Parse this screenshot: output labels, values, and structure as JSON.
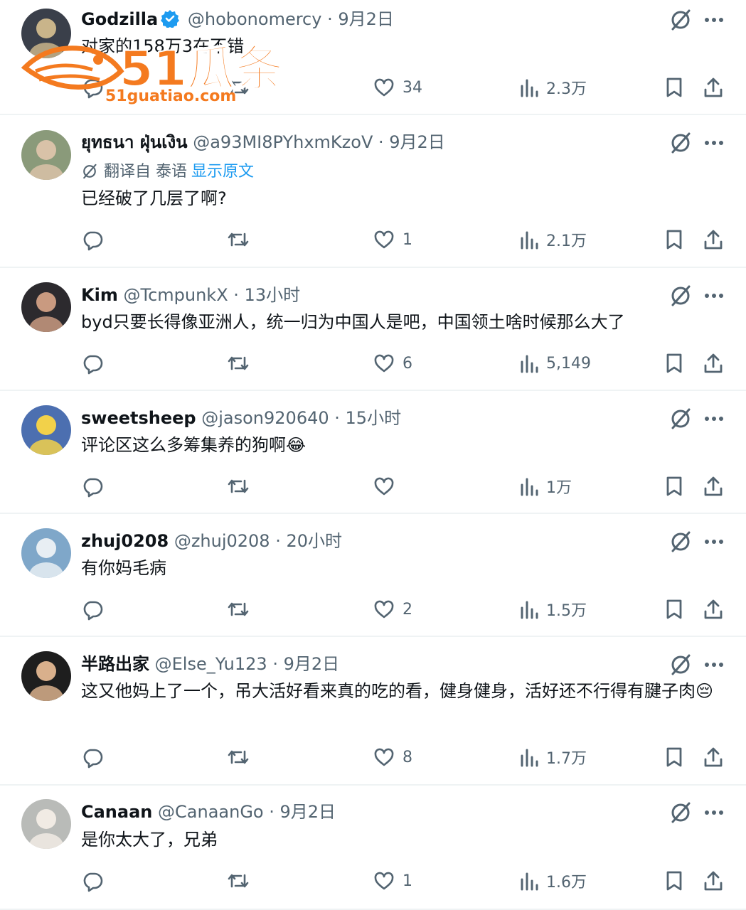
{
  "tweets": [
    {
      "name": "Godzilla",
      "handle": "@hobonomercy",
      "time": "9月2日",
      "verified": true,
      "translate": null,
      "text": "对家的158万3在不错",
      "counts": {
        "reply": "",
        "retweet": "",
        "like": "34",
        "views": "2.3万"
      }
    },
    {
      "name": "ยุทธนา ฝุ่นเงิน",
      "handle": "@a93MI8PYhxmKzoV",
      "time": "9月2日",
      "verified": false,
      "translate": {
        "label": "翻译自 泰语",
        "link": "显示原文"
      },
      "text": "已经破了几层了啊?",
      "counts": {
        "reply": "",
        "retweet": "",
        "like": "1",
        "views": "2.1万"
      }
    },
    {
      "name": "Kim",
      "handle": "@TcmpunkX",
      "time": "13小时",
      "verified": false,
      "translate": null,
      "text": "byd只要长得像亚洲人，统一归为中国人是吧，中国领土啥时候那么大了",
      "counts": {
        "reply": "",
        "retweet": "",
        "like": "6",
        "views": "5,149"
      }
    },
    {
      "name": "sweetsheep",
      "handle": "@jason920640",
      "time": "15小时",
      "verified": false,
      "translate": null,
      "text": "评论区这么多筹集养的狗啊😂",
      "counts": {
        "reply": "",
        "retweet": "",
        "like": "",
        "views": "1万"
      }
    },
    {
      "name": "zhuj0208",
      "handle": "@zhuj0208",
      "time": "20小时",
      "verified": false,
      "translate": null,
      "text": "有你妈毛病",
      "counts": {
        "reply": "",
        "retweet": "",
        "like": "2",
        "views": "1.5万"
      }
    },
    {
      "name": "半路出家",
      "handle": "@Else_Yu123",
      "time": "9月2日",
      "verified": false,
      "translate": null,
      "text": "这又他妈上了一个，吊大活好看来真的吃的看，健身健身，活好还不行得有腱子肉😔",
      "counts": {
        "reply": "",
        "retweet": "",
        "like": "8",
        "views": "1.7万"
      }
    },
    {
      "name": "Canaan",
      "handle": "@CanaanGo",
      "time": "9月2日",
      "verified": false,
      "translate": null,
      "text": "是你太大了，兄弟",
      "counts": {
        "reply": "",
        "retweet": "",
        "like": "1",
        "views": "1.6万"
      }
    }
  ],
  "watermark": {
    "brand": "51瓜条",
    "url": "51guatiao.com"
  },
  "colors": {
    "text": "#0f1419",
    "secondary": "#536471",
    "link": "#1d9bf0",
    "divider": "#eff3f4",
    "watermark": "#f47a1f"
  },
  "icons": [
    "verified-badge-icon",
    "grok-icon",
    "more-icon",
    "translate-icon",
    "reply-icon",
    "retweet-icon",
    "like-icon",
    "views-icon",
    "bookmark-icon",
    "share-icon"
  ]
}
